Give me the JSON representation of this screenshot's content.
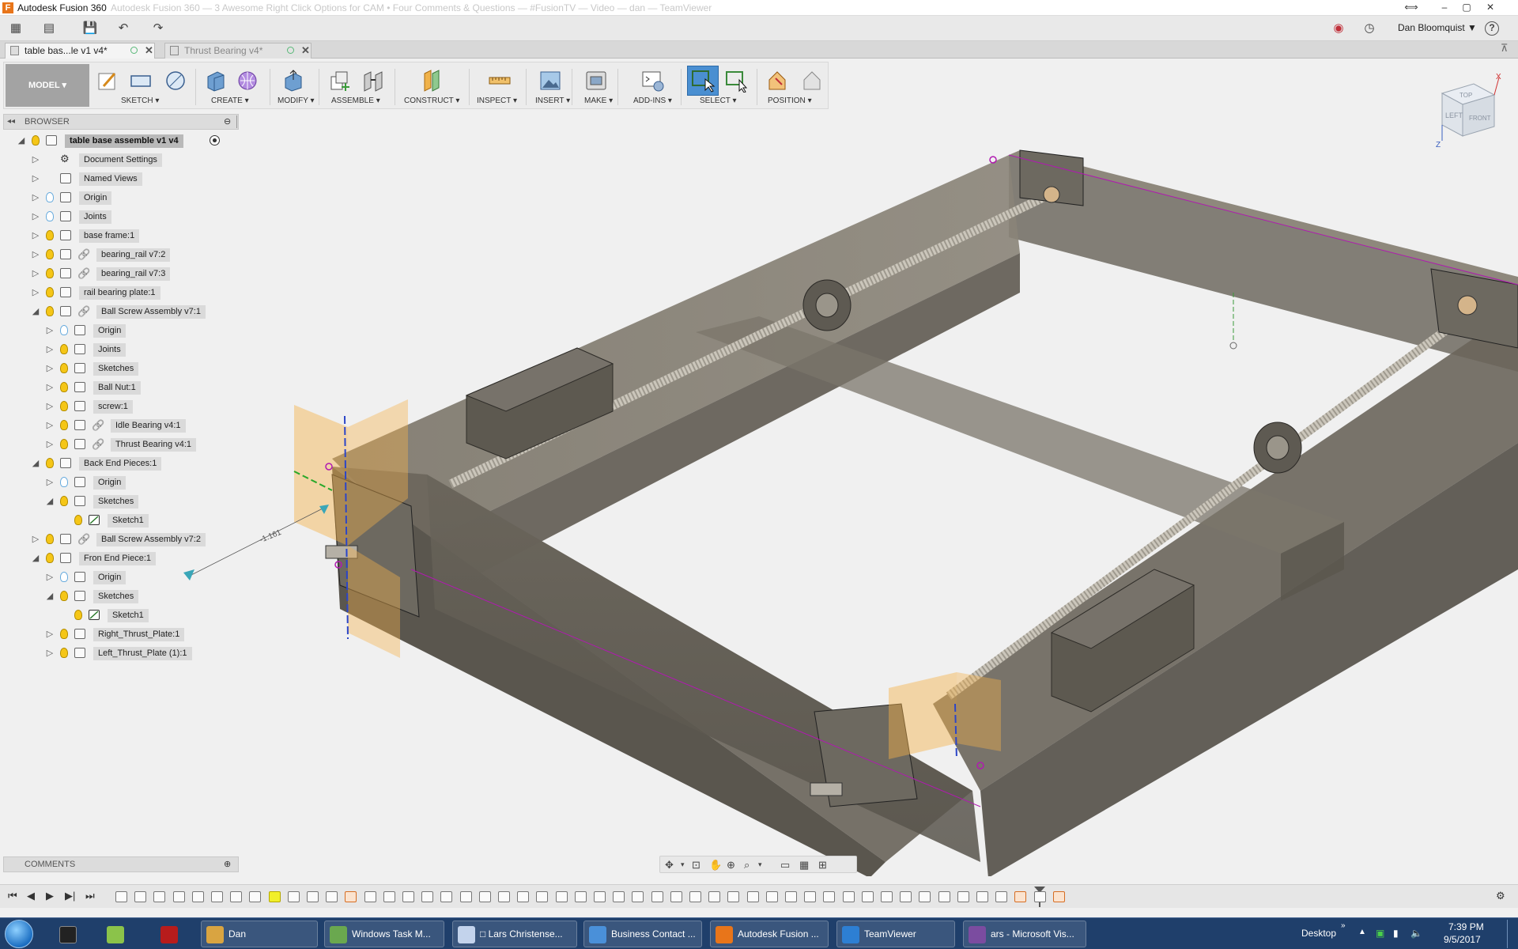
{
  "window": {
    "title": "Autodesk Fusion 360",
    "title_ghost": "Autodesk Fusion 360 — 3 Awesome Right Click Options for CAM • Four Comments & Questions — #FusionTV — Video — dan — TeamViewer"
  },
  "quick_access": {
    "user_name": "Dan Bloomquist ▼",
    "help_label": "?"
  },
  "tabs": [
    {
      "label": "table bas...le v1 v4*",
      "active": true
    },
    {
      "label": "Thrust Bearing v4*",
      "active": false
    }
  ],
  "toolbar": {
    "workspace": "MODEL",
    "groups": [
      {
        "label": "SKETCH"
      },
      {
        "label": "CREATE"
      },
      {
        "label": "MODIFY"
      },
      {
        "label": "ASSEMBLE"
      },
      {
        "label": "CONSTRUCT"
      },
      {
        "label": "INSPECT"
      },
      {
        "label": "INSERT"
      },
      {
        "label": "MAKE"
      },
      {
        "label": "ADD-INS"
      },
      {
        "label": "SELECT"
      },
      {
        "label": "POSITION"
      }
    ]
  },
  "browser": {
    "header": "BROWSER",
    "items": [
      {
        "label": "table base assemble v1 v4",
        "level": 0,
        "expanded": true,
        "bulb": true,
        "root": true
      },
      {
        "label": "Document Settings",
        "level": 1,
        "expanded": false,
        "bulb": false,
        "icon": "gear-icon"
      },
      {
        "label": "Named Views",
        "level": 1,
        "expanded": false,
        "bulb": false,
        "icon": "folder-icon"
      },
      {
        "label": "Origin",
        "level": 1,
        "expanded": false,
        "bulb": "off",
        "icon": "folder-icon"
      },
      {
        "label": "Joints",
        "level": 1,
        "expanded": false,
        "bulb": "off",
        "icon": "folder-icon"
      },
      {
        "label": "base frame:1",
        "level": 1,
        "expanded": false,
        "bulb": true,
        "icon": "component-icon"
      },
      {
        "label": "bearing_rail v7:2",
        "level": 1,
        "expanded": false,
        "bulb": true,
        "icon": "component-icon",
        "linked": true
      },
      {
        "label": "bearing_rail v7:3",
        "level": 1,
        "expanded": false,
        "bulb": true,
        "icon": "component-icon",
        "linked": true
      },
      {
        "label": "rail bearing plate:1",
        "level": 1,
        "expanded": false,
        "bulb": true,
        "icon": "component-icon"
      },
      {
        "label": "Ball Screw Assembly v7:1",
        "level": 1,
        "expanded": true,
        "bulb": true,
        "icon": "component-icon",
        "linked": true
      },
      {
        "label": "Origin",
        "level": 2,
        "expanded": false,
        "bulb": "off",
        "icon": "folder-icon"
      },
      {
        "label": "Joints",
        "level": 2,
        "expanded": false,
        "bulb": true,
        "icon": "folder-icon"
      },
      {
        "label": "Sketches",
        "level": 2,
        "expanded": false,
        "bulb": true,
        "icon": "folder-icon"
      },
      {
        "label": "Ball Nut:1",
        "level": 2,
        "expanded": false,
        "bulb": true,
        "icon": "component-icon"
      },
      {
        "label": "screw:1",
        "level": 2,
        "expanded": false,
        "bulb": true,
        "icon": "component-icon"
      },
      {
        "label": "Idle Bearing v4:1",
        "level": 2,
        "expanded": false,
        "bulb": true,
        "icon": "component-icon",
        "linked": true
      },
      {
        "label": "Thrust Bearing v4:1",
        "level": 2,
        "expanded": false,
        "bulb": true,
        "icon": "component-icon",
        "linked": true
      },
      {
        "label": "Back End Pieces:1",
        "level": 1,
        "expanded": true,
        "bulb": true,
        "icon": "component-icon"
      },
      {
        "label": "Origin",
        "level": 2,
        "expanded": false,
        "bulb": "off",
        "icon": "folder-icon"
      },
      {
        "label": "Sketches",
        "level": 2,
        "expanded": true,
        "bulb": true,
        "icon": "folder-icon"
      },
      {
        "label": "Sketch1",
        "level": 3,
        "expanded": null,
        "bulb": true,
        "icon": "sketch-icon"
      },
      {
        "label": "Ball Screw Assembly v7:2",
        "level": 1,
        "expanded": false,
        "bulb": true,
        "icon": "component-icon",
        "linked": true
      },
      {
        "label": "Fron End Piece:1",
        "level": 1,
        "expanded": true,
        "bulb": true,
        "icon": "component-icon"
      },
      {
        "label": "Origin",
        "level": 2,
        "expanded": false,
        "bulb": "off",
        "icon": "folder-icon"
      },
      {
        "label": "Sketches",
        "level": 2,
        "expanded": true,
        "bulb": true,
        "icon": "folder-icon"
      },
      {
        "label": "Sketch1",
        "level": 3,
        "expanded": null,
        "bulb": true,
        "icon": "sketch-icon"
      },
      {
        "label": "Right_Thrust_Plate:1",
        "level": 2,
        "expanded": false,
        "bulb": true,
        "icon": "component-icon"
      },
      {
        "label": "Left_Thrust_Plate (1):1",
        "level": 2,
        "expanded": false,
        "bulb": true,
        "icon": "component-icon"
      }
    ]
  },
  "viewport": {
    "dimension_label": "-1.161",
    "viewcube_faces": {
      "top": "TOP",
      "left": "LEFT",
      "right": "FRONT"
    },
    "axis_labels": {
      "x": "X",
      "z": "Z"
    }
  },
  "comments": {
    "header": "COMMENTS"
  },
  "timeline": {
    "feature_count": 50,
    "highlighted_index": 8
  },
  "taskbar": {
    "items": [
      {
        "label": "Dan",
        "color": "#d9a441"
      },
      {
        "label": "Windows Task M...",
        "color": "#6aa84f"
      },
      {
        "label": "□ Lars Christense...",
        "color": "#c3d3ec"
      },
      {
        "label": "Business Contact ...",
        "color": "#4a90d9"
      },
      {
        "label": "Autodesk Fusion ...",
        "color": "#e8751a"
      },
      {
        "label": "TeamViewer",
        "color": "#2d7fd3"
      },
      {
        "label": "ars - Microsoft Vis...",
        "color": "#7b4ca0"
      }
    ],
    "tray_label": "Desktop",
    "time": "7:39 PM",
    "date": "9/5/2017"
  }
}
